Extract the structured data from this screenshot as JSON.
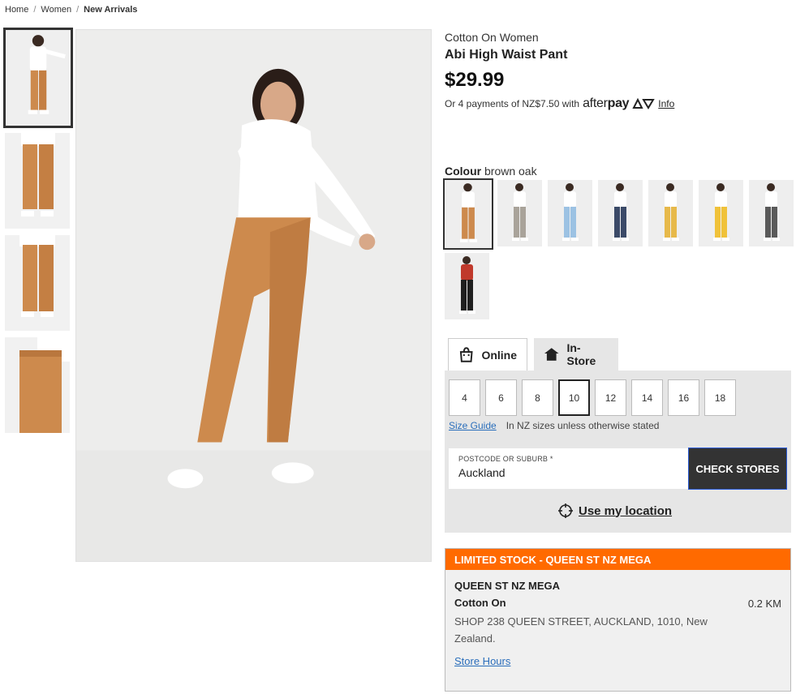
{
  "breadcrumb": {
    "home": "Home",
    "women": "Women",
    "current": "New Arrivals",
    "sep": "/"
  },
  "product": {
    "brand": "Cotton On Women",
    "title": "Abi High Waist Pant",
    "price": "$29.99",
    "afterpay_text": "Or 4 payments of NZ$7.50 with",
    "afterpay_logo_a": "after",
    "afterpay_logo_b": "pay",
    "afterpay_info": "Info"
  },
  "colour": {
    "label": "Colour",
    "value": "brown oak",
    "swatches": [
      {
        "name": "brown oak",
        "pant": "#cd8a4d",
        "top": "#ffffff"
      },
      {
        "name": "grey check",
        "pant": "#a9a39a",
        "top": "#ffffff"
      },
      {
        "name": "light blue",
        "pant": "#9cc2e3",
        "top": "#ffffff"
      },
      {
        "name": "navy check",
        "pant": "#3b4a68",
        "top": "#ffffff"
      },
      {
        "name": "mustard",
        "pant": "#e7b94a",
        "top": "#ffffff"
      },
      {
        "name": "yellow",
        "pant": "#f0c23a",
        "top": "#ffffff"
      },
      {
        "name": "black check",
        "pant": "#5a5a5a",
        "top": "#ffffff"
      },
      {
        "name": "black",
        "pant": "#1f1f1f",
        "top": "#c0392b"
      }
    ]
  },
  "tabs": {
    "online": "Online",
    "instore": "In-Store"
  },
  "sizes": [
    "4",
    "6",
    "8",
    "10",
    "12",
    "14",
    "16",
    "18"
  ],
  "selected_size": "10",
  "size_guide": "Size Guide",
  "size_note": "In NZ sizes unless otherwise stated",
  "postcode": {
    "label": "POSTCODE OR SUBURB *",
    "value": "Auckland"
  },
  "check_stores": "CHECK STORES",
  "use_location": "Use my location",
  "stock": {
    "header": "LIMITED STOCK - QUEEN ST NZ MEGA",
    "store_name": "QUEEN ST NZ MEGA",
    "store_brand": "Cotton On",
    "distance": "0.2 KM",
    "address": "SHOP 238 QUEEN STREET, AUCKLAND, 1010, New Zealand.",
    "hours": "Store Hours"
  },
  "colors": {
    "accent_orange": "#ff6a00",
    "link_blue": "#2a6ebb",
    "dark_button": "#333333"
  }
}
